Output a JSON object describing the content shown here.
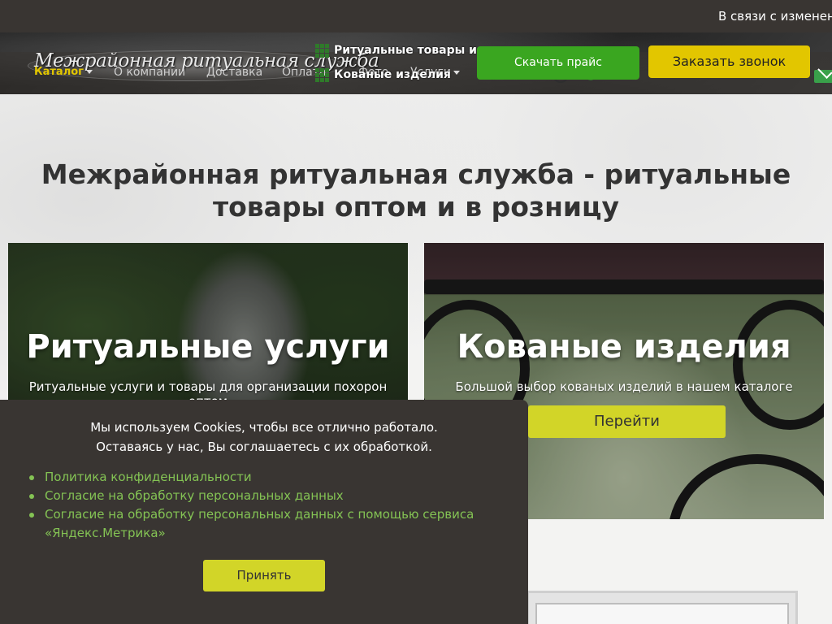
{
  "announcement": {
    "text": "В связи с изменени"
  },
  "header": {
    "logo_text": "Межрайонная ритуальная служба",
    "nav": [
      {
        "label": "Каталог",
        "has_dropdown": true
      },
      {
        "label": "О компании"
      },
      {
        "label": "Доставка"
      },
      {
        "label": "Оплата"
      },
      {
        "label": "Фото"
      },
      {
        "label": "Услуги",
        "has_dropdown": true
      }
    ],
    "promo": {
      "line1": "Ритуальные товары и",
      "line2": "Кованые изделия"
    },
    "price_button": "Скачать прайс",
    "call_button": "Заказать звонок",
    "icons": [
      "whatsapp-icon",
      "phone-icon",
      "mail-icon"
    ]
  },
  "main": {
    "title_line1": "Межрайонная ритуальная служба - ритуальные",
    "title_line2": "товары оптом и в розницу"
  },
  "cards": [
    {
      "title": "Ритуальные услуги",
      "subtitle": "Ритуальные услуги и товары для организации похорон оптом"
    },
    {
      "title": "Кованые изделия",
      "subtitle": "Большой выбор кованых изделий в нашем каталоге",
      "button": "Перейти"
    }
  ],
  "cookie": {
    "line1": "Мы используем Cookies, чтобы все отлично работало.",
    "line2": "Оставаясь у нас, Вы соглашаетесь с их обработкой.",
    "links": [
      "Политика конфиденциальности",
      "Согласие на обработку персональных данных",
      "Согласие на обработку персональных данных с помощью сервиса «Яндекс.Метрика»"
    ],
    "accept_button": "Принять"
  },
  "colors": {
    "dark": "#393532",
    "accent_yellow": "#e2c600",
    "accent_green": "#3aa620",
    "button_lime": "#d2d528",
    "link_green": "#84c354"
  }
}
